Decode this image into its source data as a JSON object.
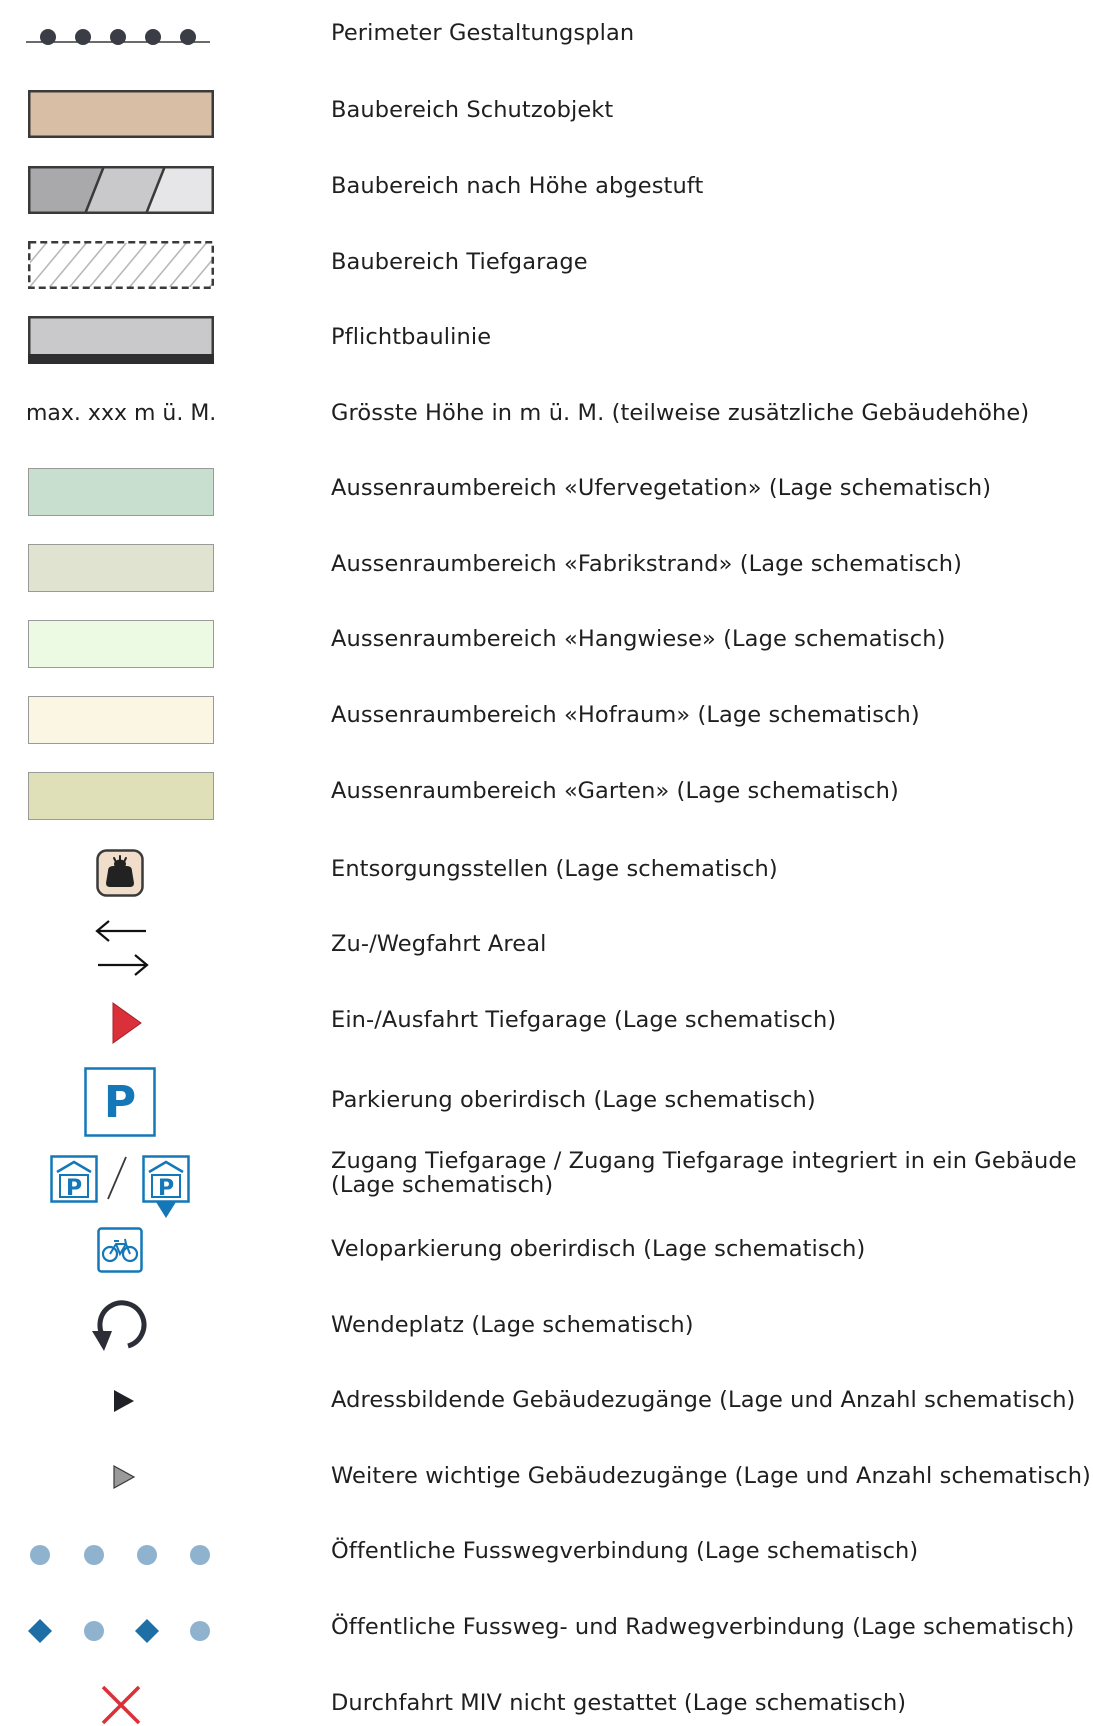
{
  "legend": {
    "items": [
      {
        "label": "Perimeter Gestaltungsplan"
      },
      {
        "label": "Baubereich Schutzobjekt",
        "color": "#d9bea6"
      },
      {
        "label": "Baubereich nach Höhe abgestuft"
      },
      {
        "label": "Baubereich Tiefgarage"
      },
      {
        "label": "Pflichtbaulinie"
      },
      {
        "label": "Grösste Höhe in m ü. M. (teilweise zusätzliche Gebäudehöhe)",
        "symbol_text": "max. xxx m ü. M."
      },
      {
        "label": "Aussenraumbereich «Ufervegetation» (Lage schematisch)",
        "color": "#c8dfcf"
      },
      {
        "label": "Aussenraumbereich «Fabrikstrand» (Lage schematisch)",
        "color": "#dfe3cf"
      },
      {
        "label": "Aussenraumbereich «Hangwiese» (Lage schematisch)",
        "color": "#ecfae3"
      },
      {
        "label": "Aussenraumbereich «Hofraum» (Lage schematisch)",
        "color": "#fbf5e4"
      },
      {
        "label": "Aussenraumbereich «Garten» (Lage schematisch)",
        "color": "#dfdfb8"
      },
      {
        "label": "Entsorgungsstellen (Lage schematisch)",
        "icon": "waste-bin-icon"
      },
      {
        "label": "Zu-/Wegfahrt Areal",
        "icon": "two-way-arrows-icon"
      },
      {
        "label": "Ein-/Ausfahrt Tiefgarage (Lage schematisch)",
        "icon": "red-triangle-icon"
      },
      {
        "label": "Parkierung oberirdisch (Lage schematisch)",
        "icon": "parking-icon",
        "symbol_text": "P"
      },
      {
        "label": "Zugang Tiefgarage / Zugang Tiefgarage integriert in ein Gebäude (Lage schematisch)",
        "icon": "underground-parking-icon",
        "symbol_text": "P"
      },
      {
        "label": "Veloparkierung oberirdisch (Lage schematisch)",
        "icon": "bicycle-icon"
      },
      {
        "label": "Wendeplatz (Lage schematisch)",
        "icon": "turning-circle-icon"
      },
      {
        "label": "Adressbildende Gebäudezugänge (Lage und Anzahl schematisch)",
        "icon": "black-triangle-icon"
      },
      {
        "label": "Weitere wichtige Gebäudezugänge (Lage und Anzahl schematisch)",
        "icon": "grey-triangle-icon"
      },
      {
        "label": "Öffentliche Fusswegverbindung (Lage schematisch)",
        "icon": "dots-icon"
      },
      {
        "label": "Öffentliche Fussweg- und Radwegverbindung (Lage schematisch)",
        "icon": "diamond-dot-icon"
      },
      {
        "label": "Durchfahrt MIV nicht gestattet (Lage schematisch)",
        "icon": "red-x-icon"
      }
    ]
  },
  "colors": {
    "outline": "#3a3a3a",
    "blue": "#1478b8",
    "red": "#d9303a",
    "dot_blue": "#8fb2cf",
    "diamond_blue": "#1d6fa5"
  }
}
